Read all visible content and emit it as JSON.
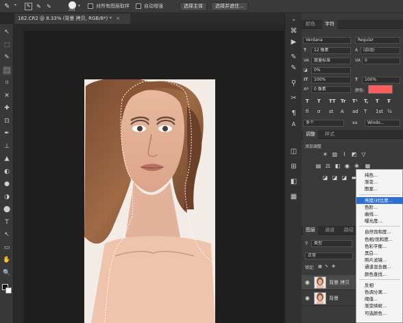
{
  "options_bar": {
    "brush_size": "250",
    "sample_all_layers_label": "对所有图层取样",
    "auto_enhance_label": "自动增强",
    "select_subject_label": "选择主体",
    "select_and_mask_label": "选择并遮住..."
  },
  "document": {
    "tab_title": "162.CR2 @ 8.33% (背景 拷贝, RGB/8*) *",
    "close_glyph": "×"
  },
  "tools": [
    "↖",
    "⬚",
    "✎",
    "⬚",
    "⌗",
    "✕",
    "✚",
    "⊡",
    "✒",
    "⊥",
    "▲",
    "◐",
    "●",
    "◑",
    "⬤",
    "T",
    "↖",
    "▭",
    "✋",
    "🔍"
  ],
  "panels": {
    "top_tabs": [
      "颜色",
      "字符"
    ],
    "active_top_tab": "字符",
    "character": {
      "font_family": "Verdana",
      "font_style": "Regular",
      "font_size": "12 像素",
      "leading": "(自动)",
      "kerning": "度量标准",
      "tracking": "0",
      "tracking_pct": "0%",
      "vscale": "100%",
      "hscale": "100%",
      "baseline": "0 像素",
      "color_label": "颜色:",
      "color_swatch": "#ff5c5c",
      "style_glyphs": [
        "T",
        "T",
        "TT",
        "Tr",
        "T¹",
        "T,",
        "T",
        "Ŧ"
      ],
      "opentype_glyphs": [
        "fi",
        "σ",
        "st",
        "A",
        "ad",
        "T",
        "1st",
        "½"
      ],
      "language": "多个",
      "aa_label": "aa",
      "aa_value": "Windo..."
    },
    "adjust_tabs": [
      "调整",
      "样式"
    ],
    "active_adjust_tab": "调整",
    "add_adjustment_label": "添加调整",
    "layers_tabs": [
      "图层",
      "通道",
      "路径"
    ],
    "active_layers_tab": "图层",
    "layer_kind": "类型",
    "blend_mode": "正常",
    "lock_label": "锁定:",
    "layers": [
      {
        "name": "背景 拷贝"
      },
      {
        "name": "背景"
      }
    ]
  },
  "adjust_menu": {
    "groups": [
      [
        "纯色...",
        "渐变...",
        "图案..."
      ],
      [
        "亮度/对比度...",
        "色阶...",
        "曲线...",
        "曝光度..."
      ],
      [
        "自然饱和度...",
        "色相/饱和度...",
        "色彩平衡...",
        "黑白...",
        "照片滤镜...",
        "通道混合器...",
        "颜色查找..."
      ],
      [
        "反相",
        "色调分离...",
        "阈值...",
        "渐变映射...",
        "可选颜色..."
      ]
    ],
    "highlighted": "亮度/对比度..."
  }
}
